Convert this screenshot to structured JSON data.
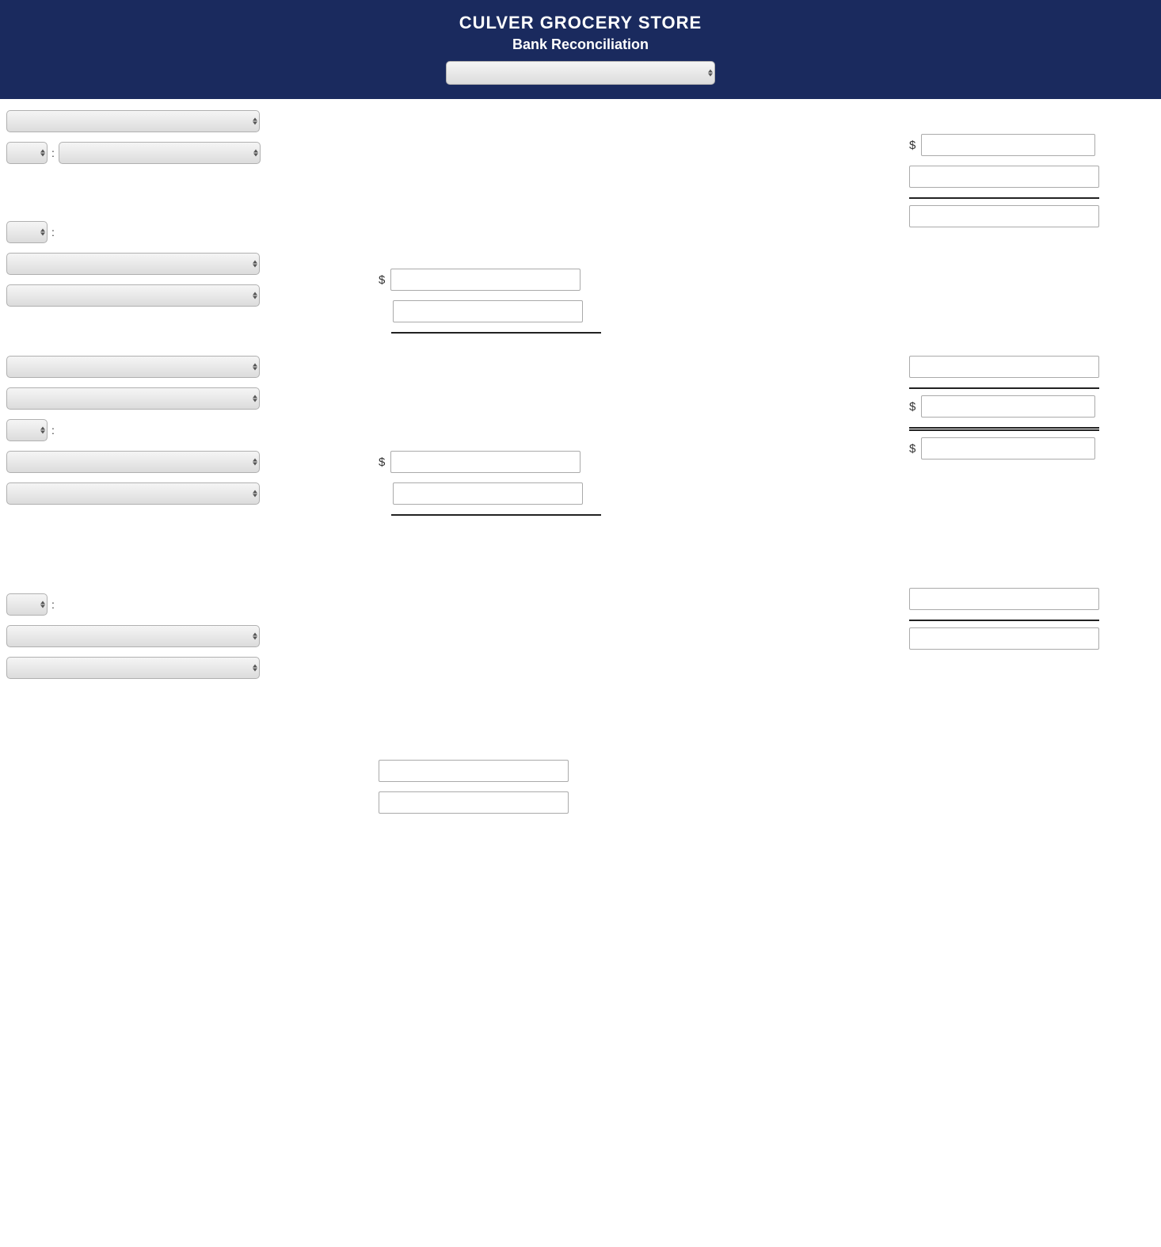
{
  "header": {
    "store_name": "CULVER GROCERY STORE",
    "subtitle": "Bank Reconciliation"
  },
  "top_dropdown": {
    "placeholder": "",
    "options": []
  },
  "left": {
    "row1_select_options": [],
    "row2a_select_options": [],
    "row2b_select_options": [],
    "row3_select_options": [],
    "row4_select_options": [],
    "row5_select_options": [],
    "row6_select_options": [],
    "row7_select_options": [],
    "row8_select_options": [],
    "row9_select_options": [],
    "row10_select_options": [],
    "row11_select_options": []
  },
  "middle": {
    "dollar_label": "$",
    "sections": [
      {
        "id": "s1",
        "input1_val": "",
        "input2_val": "",
        "input3_val": ""
      },
      {
        "id": "s2",
        "input1_val": "",
        "input2_val": "",
        "input3_val": ""
      }
    ]
  },
  "right": {
    "dollar_label": "$",
    "inputs": [
      {
        "id": "r1",
        "val": ""
      },
      {
        "id": "r2",
        "val": ""
      },
      {
        "id": "r3",
        "val": ""
      },
      {
        "id": "r4",
        "val": ""
      },
      {
        "id": "r5",
        "val": ""
      },
      {
        "id": "r6",
        "val": ""
      },
      {
        "id": "r7",
        "val": ""
      },
      {
        "id": "r8",
        "val": ""
      },
      {
        "id": "r9",
        "val": ""
      }
    ]
  }
}
